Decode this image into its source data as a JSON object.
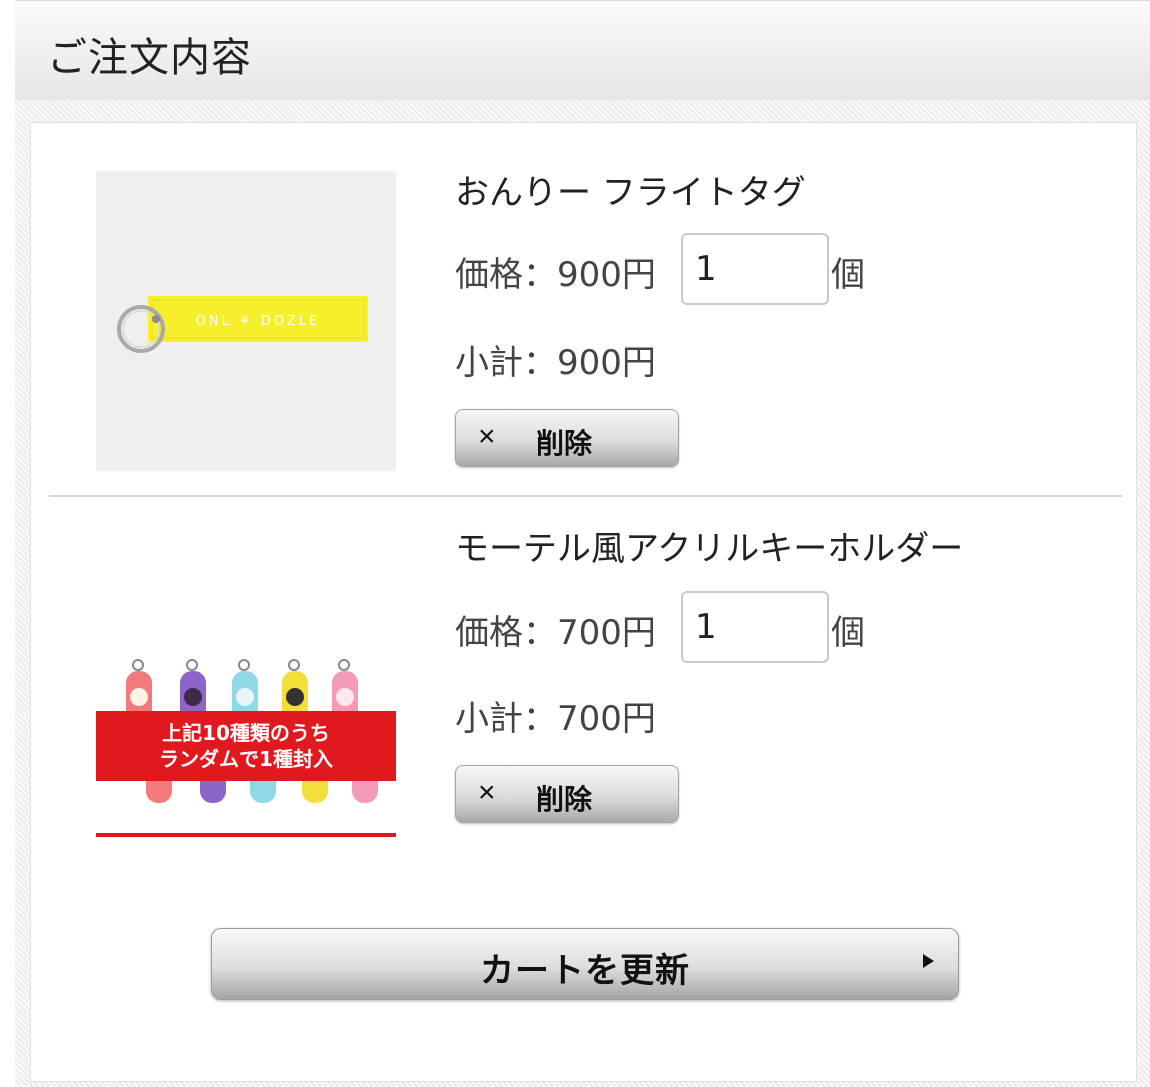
{
  "header": {
    "title": "ご注文内容"
  },
  "items": [
    {
      "name": "おんりー フライトタグ",
      "price_text": "価格：900円",
      "quantity": "1",
      "unit": "個",
      "subtotal_text": "小計：900円",
      "delete_icon": "×",
      "delete_label": "削除",
      "image": {
        "tag_text": "ONL ⚘ DOZLE",
        "colors": {
          "tag": "#f7ee2c",
          "ring": "#b0b0b0"
        }
      }
    },
    {
      "name": "モーテル風アクリルキーホルダー",
      "price_text": "価格：700円",
      "quantity": "1",
      "unit": "個",
      "subtotal_text": "小計：700円",
      "delete_icon": "×",
      "delete_label": "削除",
      "image": {
        "banner_line1": "上記10種類のうち",
        "banner_line2": "ランダムで1種封入",
        "colors": {
          "banner": "#e0191f"
        }
      }
    }
  ],
  "update_button": {
    "label": "カートを更新",
    "icon": "play-arrow-icon"
  }
}
